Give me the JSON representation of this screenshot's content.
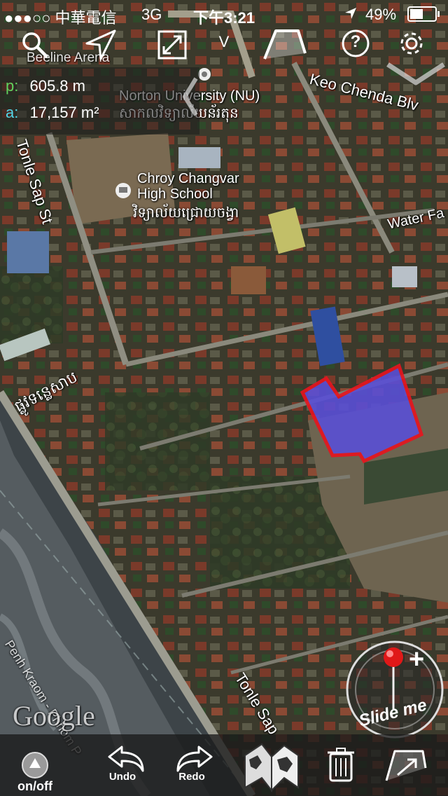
{
  "status_bar": {
    "carrier": "●●●○○ 中華電信",
    "network": "3G",
    "time": "下午3:21",
    "battery": "49%"
  },
  "toolbar_top": {
    "dropdown_symbol": "V",
    "help_symbol": "?"
  },
  "measurement": {
    "perimeter_key": "p:",
    "perimeter_value": "605.8 m",
    "area_key": "a:",
    "area_value": "17,157 m²",
    "perimeter_color": "#5fd35f",
    "area_color": "#4fd6e8"
  },
  "map": {
    "labels": {
      "beeline_arena": "Beeline Arena",
      "norton_university": "Norton University (NU)",
      "norton_khmer": "សាកលវិទ្យាល័យន័រតុន",
      "keo_chenda": "Keo Chenda Blv",
      "tonle_sap_st_top": "Tonle Sap St",
      "chroy_changvar": "Chroy Changvar",
      "high_school": "High School",
      "chroy_khmer": "វិទ្យាល័យជ្រោយចង្វា",
      "water_fa": "Water Fa",
      "tonle_sap_khmer": "ផ្លូវទន្លេសាប",
      "tonle_sap_bottom": "Tonle Sap",
      "phnom_penh_kraom": "Penh Kraom - Phnom P"
    },
    "polygon_fill": "#5a4fd6",
    "polygon_stroke": "#e8141e",
    "attribution": "Google"
  },
  "slide_control": {
    "label": "Slide me",
    "plus": "+"
  },
  "bottom_bar": {
    "onoff_label": "on/off",
    "undo_label": "Undo",
    "redo_label": "Redo"
  }
}
